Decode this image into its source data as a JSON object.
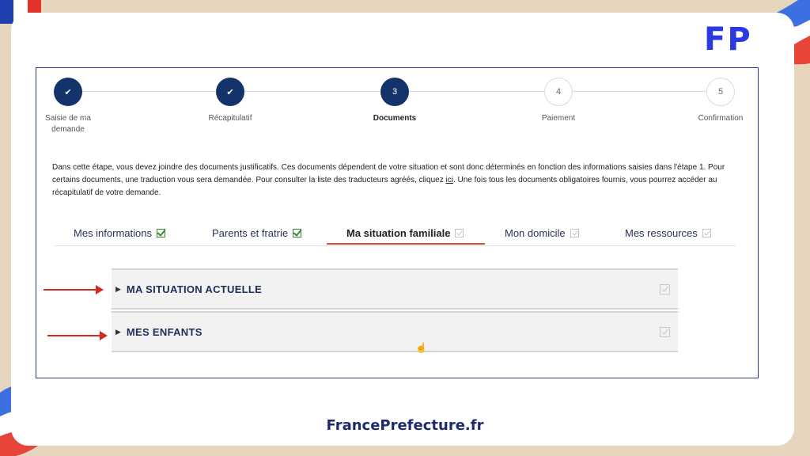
{
  "brand": {
    "logo": "FP",
    "footer": "FrancePrefecture.fr",
    "colors": {
      "accent": "#2b39e2",
      "navy": "#14336b",
      "red": "#d32b1e"
    }
  },
  "stepper": {
    "steps": [
      {
        "number": "",
        "label": "Saisie de ma demande",
        "state": "done",
        "icon": "check-icon"
      },
      {
        "number": "",
        "label": "Récapitulatif",
        "state": "done",
        "icon": "check-icon"
      },
      {
        "number": "3",
        "label": "Documents",
        "state": "active"
      },
      {
        "number": "4",
        "label": "Paiement",
        "state": "todo"
      },
      {
        "number": "5",
        "label": "Confirmation",
        "state": "todo"
      }
    ]
  },
  "intro": {
    "part1": "Dans cette étape, vous devez joindre des documents justificatifs. Ces documents dépendent de votre situation et sont donc déterminés en fonction des informations saisies dans l'étape 1. Pour certains documents, une traduction vous sera demandée. Pour consulter la liste des traducteurs agréés, cliquez ",
    "link": "ici",
    "part2": ". Une fois tous les documents obligatoires fournis, vous pourrez accéder au récapitulatif de votre demande."
  },
  "tabs": [
    {
      "label": "Mes informations",
      "checked": true
    },
    {
      "label": "Parents et fratrie",
      "checked": true
    },
    {
      "label": "Ma situation familiale",
      "checked": false,
      "active": true
    },
    {
      "label": "Mon domicile",
      "checked": false
    },
    {
      "label": "Mes ressources",
      "checked": false
    }
  ],
  "sections": [
    {
      "title": "MA SITUATION ACTUELLE"
    },
    {
      "title": "MES ENFANTS"
    }
  ]
}
